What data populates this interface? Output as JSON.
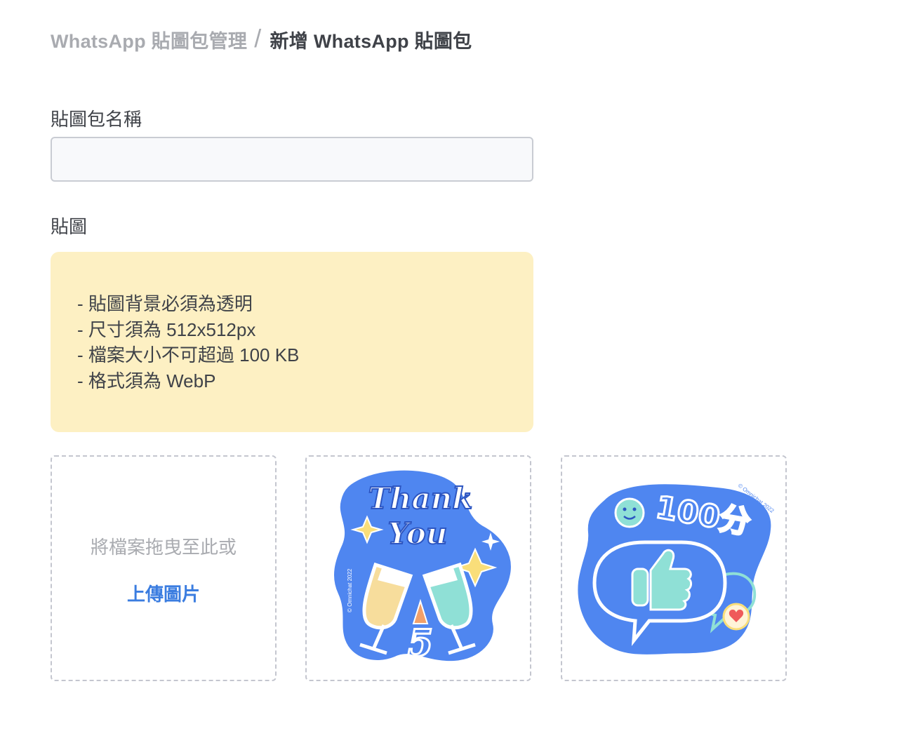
{
  "breadcrumb": {
    "parent": "WhatsApp 貼圖包管理",
    "separator": "/",
    "current": "新增 WhatsApp 貼圖包"
  },
  "form": {
    "name_label": "貼圖包名稱",
    "name_value": "",
    "stickers_label": "貼圖",
    "requirements": [
      "- 貼圖背景必須為透明",
      "- 尺寸須為 512x512px",
      "- 檔案大小不可超過 100 KB",
      "- 格式須為 WebP"
    ]
  },
  "upload": {
    "drop_hint": "將檔案拖曳至此或",
    "upload_link": "上傳圖片"
  },
  "stickers": [
    {
      "line1": "Thank",
      "line2": "You",
      "number": "5",
      "watermark": "© Omnichat 2022",
      "icon": "champagne-toast-icon"
    },
    {
      "text": "100分",
      "watermark": "© Omnichat 2022",
      "icon": "thumbs-up-icon"
    }
  ],
  "colors": {
    "sticker_blue": "#4f86f0",
    "notice_bg": "#fdf0c3",
    "link_blue": "#3b7de0",
    "teal": "#8fe0d6",
    "cream": "#f7dd9c",
    "heart_red": "#ef5a5a",
    "sparkle_yellow": "#f9de7a"
  }
}
